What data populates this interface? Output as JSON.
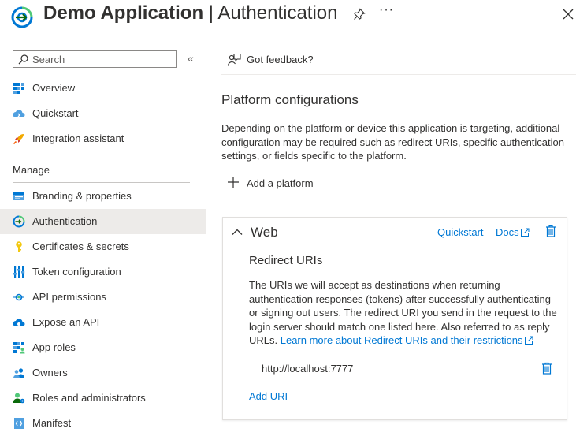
{
  "header": {
    "app_name": "Demo Application",
    "separator": " | ",
    "page_title": "Authentication",
    "more_label": "···"
  },
  "sidebar": {
    "search_placeholder": "Search",
    "collapse_label": "«",
    "items_top": [
      {
        "label": "Overview",
        "icon": "overview-grid-icon"
      },
      {
        "label": "Quickstart",
        "icon": "quickstart-cloud-icon"
      },
      {
        "label": "Integration assistant",
        "icon": "rocket-icon"
      }
    ],
    "section_label": "Manage",
    "items_manage": [
      {
        "label": "Branding & properties",
        "icon": "branding-icon"
      },
      {
        "label": "Authentication",
        "icon": "authentication-icon",
        "selected": true
      },
      {
        "label": "Certificates & secrets",
        "icon": "key-icon"
      },
      {
        "label": "Token configuration",
        "icon": "token-bars-icon"
      },
      {
        "label": "API permissions",
        "icon": "api-permissions-icon"
      },
      {
        "label": "Expose an API",
        "icon": "expose-api-cloud-icon"
      },
      {
        "label": "App roles",
        "icon": "app-roles-grid-icon"
      },
      {
        "label": "Owners",
        "icon": "owners-people-icon"
      },
      {
        "label": "Roles and administrators",
        "icon": "roles-admin-icon"
      },
      {
        "label": "Manifest",
        "icon": "manifest-icon"
      }
    ]
  },
  "main": {
    "feedback_label": "Got feedback?",
    "title": "Platform configurations",
    "description": "Depending on the platform or device this application is targeting, additional configuration may be required such as redirect URIs, specific authentication settings, or fields specific to the platform.",
    "add_platform_label": "Add a platform",
    "card": {
      "title": "Web",
      "quickstart_label": "Quickstart",
      "docs_label": "Docs",
      "redirect_title": "Redirect URIs",
      "redirect_desc": "The URIs we will accept as destinations when returning authentication responses (tokens) after successfully authenticating or signing out users. The redirect URI you send in the request to the login server should match one listed here. Also referred to as reply URLs. ",
      "learn_more_label": "Learn more about Redirect URIs and their restrictions",
      "uris": [
        "http://localhost:7777"
      ],
      "add_uri_label": "Add URI"
    }
  },
  "colors": {
    "accent": "#0078d4",
    "selected_bg": "#edebe9",
    "text": "#323130"
  }
}
